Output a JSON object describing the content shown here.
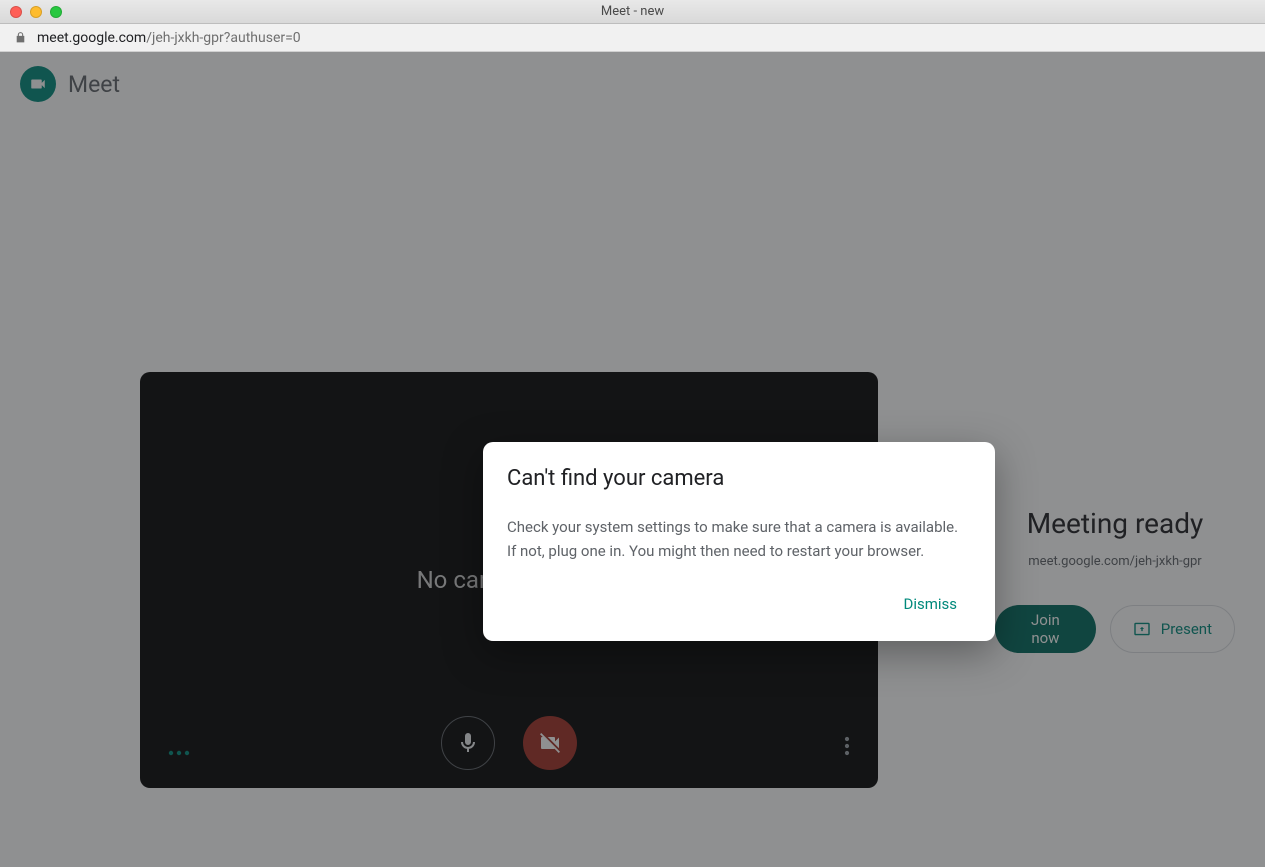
{
  "window": {
    "title": "Meet - new"
  },
  "url": {
    "host": "meet.google.com",
    "path": "/jeh-jxkh-gpr?authuser=0"
  },
  "header": {
    "brand": "Meet"
  },
  "preview": {
    "no_camera_message": "No camera found",
    "mic_icon": "microphone-icon",
    "cam_icon": "videocam-off-icon",
    "more_h_icon": "more-horizontal-icon",
    "more_v_icon": "more-vertical-icon"
  },
  "ready": {
    "title": "Meeting ready",
    "meeting_url": "meet.google.com/jeh-jxkh-gpr",
    "join_label": "Join now",
    "present_label": "Present",
    "present_icon": "present-to-all-icon"
  },
  "dialog": {
    "title": "Can't find your camera",
    "body": "Check your system settings to make sure that a camera is available. If not, plug one in. You might then need to restart your browser.",
    "dismiss_label": "Dismiss"
  },
  "colors": {
    "accent": "#00897b",
    "accent_dark": "#00695c",
    "danger": "#a03026"
  }
}
